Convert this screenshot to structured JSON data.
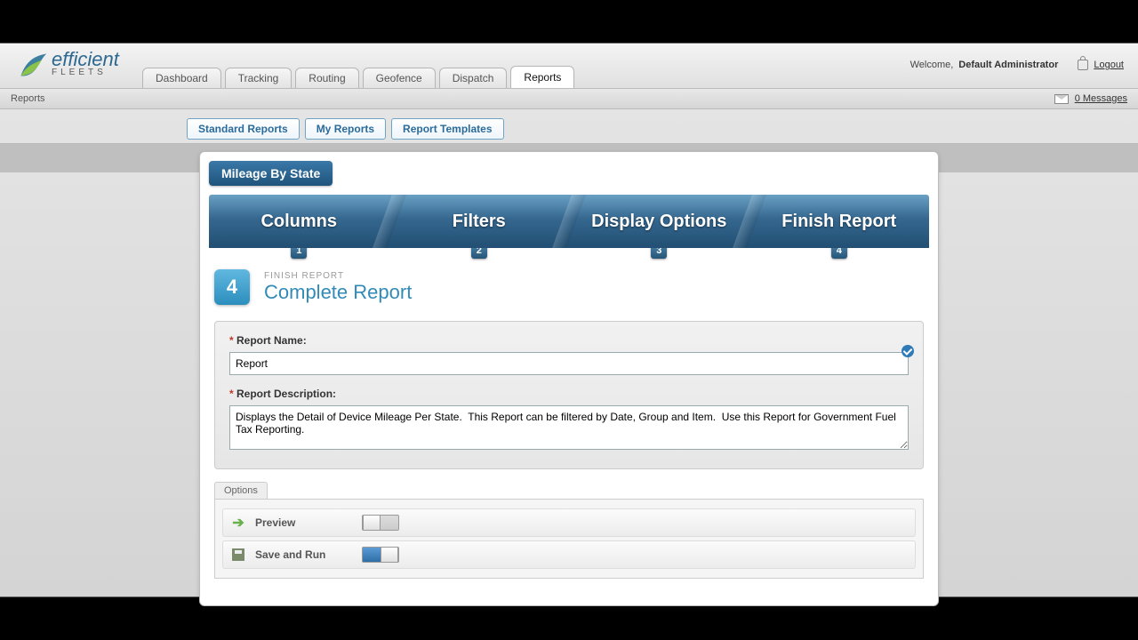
{
  "logo": {
    "line1": "efficient",
    "line2": "FLEETS"
  },
  "main_tabs": [
    "Dashboard",
    "Tracking",
    "Routing",
    "Geofence",
    "Dispatch",
    "Reports"
  ],
  "active_main_tab": 5,
  "welcome": {
    "prefix": "Welcome,",
    "user": "Default Administrator",
    "logout": "Logout"
  },
  "subbar": {
    "left": "Reports",
    "messages": "0 Messages"
  },
  "sub_tabs": [
    "Standard Reports",
    "My Reports",
    "Report Templates"
  ],
  "chip": "Mileage By State",
  "wizard_steps": [
    "Columns",
    "Filters",
    "Display Options",
    "Finish Report"
  ],
  "step": {
    "number": "4",
    "eyebrow": "FINISH REPORT",
    "title": "Complete Report"
  },
  "form": {
    "name_label": "Report Name:",
    "name_value": "Report",
    "desc_label": "Report Description:",
    "desc_value": "Displays the Detail of Device Mileage Per State.  This Report can be filtered by Date, Group and Item.  Use this Report for Government Fuel Tax Reporting."
  },
  "options": {
    "title": "Options",
    "rows": [
      {
        "label": "Preview",
        "on": false
      },
      {
        "label": "Save and Run",
        "on": true
      }
    ]
  }
}
